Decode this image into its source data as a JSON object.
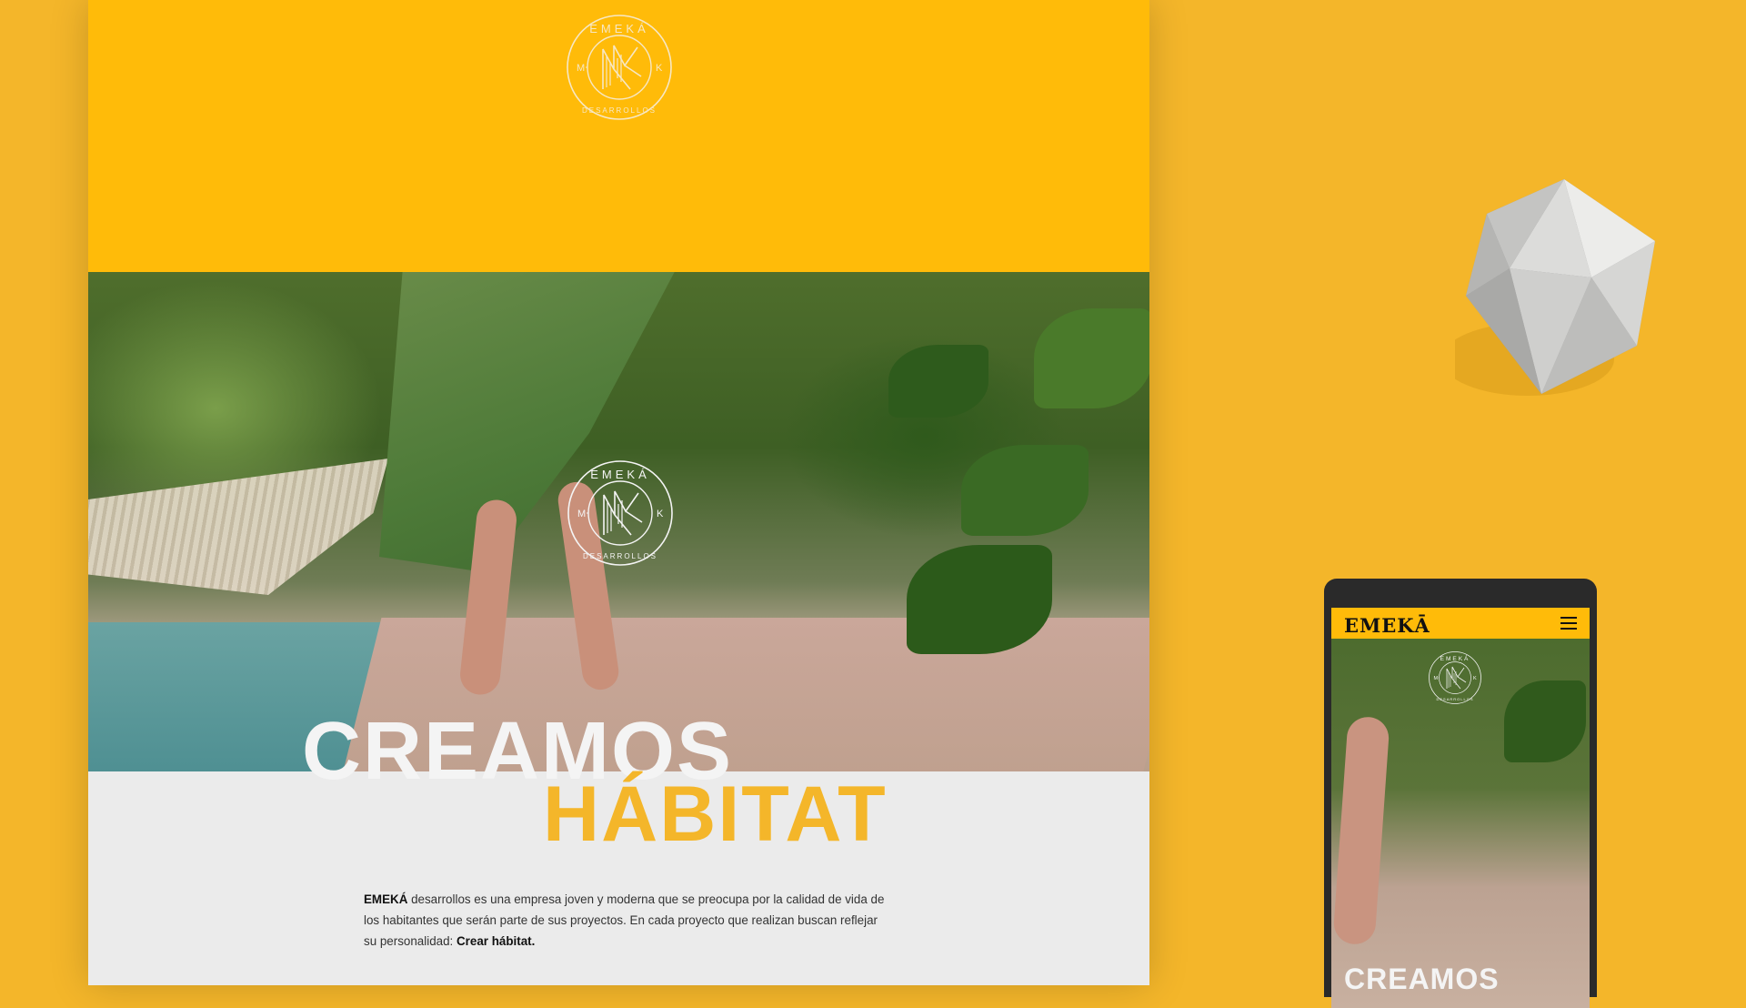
{
  "brand": {
    "logo_ring_text": "EMEKÁ",
    "logo_side_left": "M",
    "logo_side_right": "K",
    "logo_bottom_text": "DESARROLLOS",
    "accent": "#FFBB09",
    "background": "#F4B62A"
  },
  "hero": {
    "headline_line1": "CREAMOS",
    "headline_line2": "HÁBITAT"
  },
  "intro": {
    "brand": "EMEKÁ",
    "text": "desarrollos es una empresa joven y moderna que se preocupa por la calidad de vida de los habitantes que serán parte de sus proyectos. En cada proyecto que realizan buscan reflejar su personalidad:",
    "highlight": "Crear hábitat."
  },
  "mobile": {
    "brand": "EMEKĀ",
    "menu_icon": "hamburger-menu-icon",
    "headline": "CREAMOS"
  }
}
